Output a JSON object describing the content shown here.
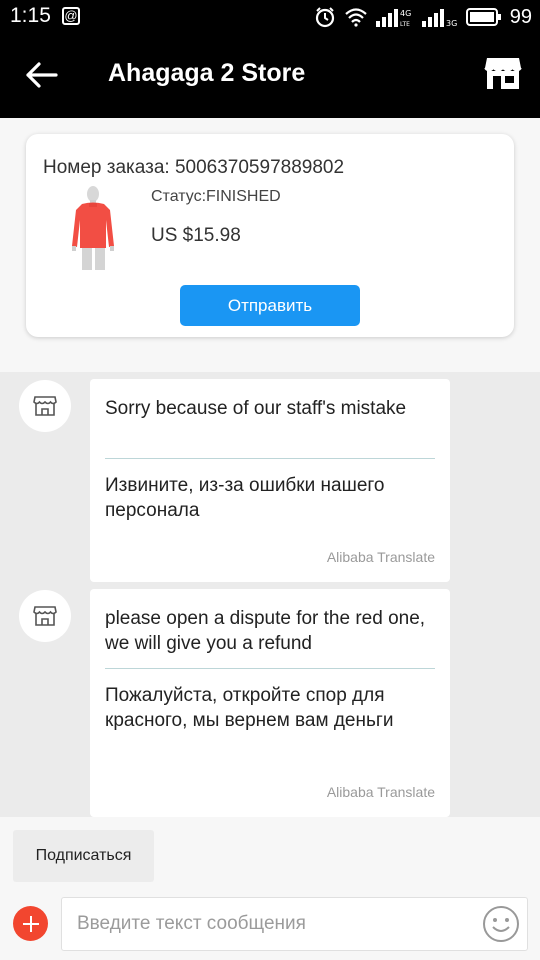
{
  "status_bar": {
    "time": "1:15",
    "notification_icon": "@",
    "battery": "99",
    "icons": [
      "alarm-icon",
      "wifi-icon",
      "signal-icon",
      "signal-icon",
      "battery-icon"
    ]
  },
  "header": {
    "title": "Ahagaga 2 Store",
    "back_icon": "arrow-left-icon",
    "store_icon": "store-icon"
  },
  "order": {
    "number": "Номер заказа: 5006370597889802",
    "status": "Статус:FINISHED",
    "price": "US $15.98",
    "send_label": "Отправить",
    "product_image": "red-long-sleeve-top"
  },
  "messages": [
    {
      "original": "Sorry because of our staff's mistake",
      "translation": "Извините, из-за ошибки нашего персонала",
      "source": "Alibaba Translate"
    },
    {
      "original": "please open a dispute for the red one, we will give you a refund",
      "translation": "Пожалуйста, откройте спор для красного, мы вернем вам деньги",
      "source": "Alibaba Translate"
    }
  ],
  "bottom": {
    "subscribe_label": "Подписаться",
    "input_placeholder": "Введите текст сообщения"
  },
  "colors": {
    "accent": "#1a96f3",
    "plus": "#f2462f",
    "header_bg": "#000000"
  }
}
